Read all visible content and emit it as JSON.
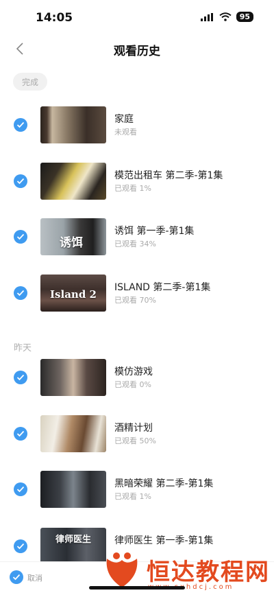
{
  "status": {
    "time": "14:05",
    "battery": "95"
  },
  "nav": {
    "title": "观看历史"
  },
  "actions": {
    "done_label": "完成",
    "cancel_label": "取消"
  },
  "sections": {
    "yesterday_label": "昨天"
  },
  "items": [
    {
      "title": "家庭",
      "progress": "未观看",
      "thumb_text": ""
    },
    {
      "title": "模范出租车 第二季-第1集",
      "progress": "已观看 1%",
      "thumb_text": ""
    },
    {
      "title": "诱饵 第一季-第1集",
      "progress": "已观看 34%",
      "thumb_text": "诱饵"
    },
    {
      "title": "ISLAND 第二季-第1集",
      "progress": "已观看 70%",
      "thumb_text": "Island 2"
    },
    {
      "title": "模仿游戏",
      "progress": "已观看 0%",
      "thumb_text": ""
    },
    {
      "title": "酒精计划",
      "progress": "已观看 50%",
      "thumb_text": ""
    },
    {
      "title": "黑暗荣耀 第二季-第1集",
      "progress": "已观看 1%",
      "thumb_text": ""
    },
    {
      "title": "律师医生 第一季-第1集",
      "progress": "",
      "thumb_text": "律师医生"
    }
  ],
  "watermark": {
    "brand": "恒达教程网",
    "url": "www.sxhdcj.com"
  },
  "colors": {
    "check": "#3f9bf0",
    "watermark": "#e34a1f"
  }
}
